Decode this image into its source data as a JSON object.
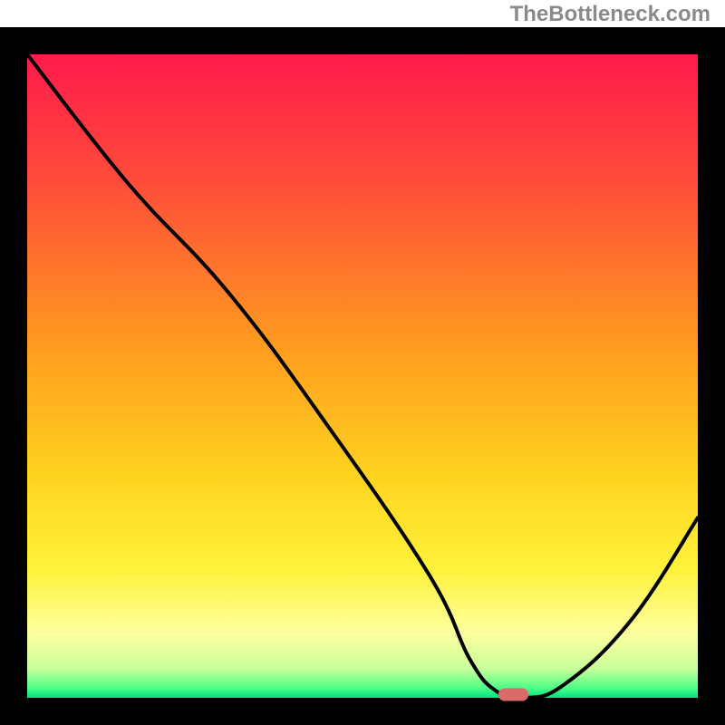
{
  "watermark": "TheBottleneck.com",
  "chart_data": {
    "type": "line",
    "title": "",
    "xlabel": "",
    "ylabel": "",
    "xlim": [
      0,
      100
    ],
    "ylim": [
      0,
      100
    ],
    "series": [
      {
        "name": "curve",
        "x": [
          0,
          15,
          30,
          45,
          60,
          66,
          70,
          74,
          80,
          90,
          100
        ],
        "values": [
          100,
          80,
          63,
          42,
          19,
          6,
          1,
          0,
          2,
          12,
          28
        ]
      }
    ],
    "marker": {
      "x": 72.5,
      "y": 0.5,
      "width": 4.5,
      "height": 2.0,
      "color": "#d96b6b"
    },
    "gradient_stops": [
      {
        "offset": 0.0,
        "color": "#ff1a4b"
      },
      {
        "offset": 0.2,
        "color": "#ff4d3a"
      },
      {
        "offset": 0.45,
        "color": "#ff9a1f"
      },
      {
        "offset": 0.65,
        "color": "#ffd21f"
      },
      {
        "offset": 0.8,
        "color": "#fff23a"
      },
      {
        "offset": 0.9,
        "color": "#fdffa0"
      },
      {
        "offset": 0.955,
        "color": "#c8ff9a"
      },
      {
        "offset": 0.985,
        "color": "#4dff88"
      },
      {
        "offset": 1.0,
        "color": "#00e080"
      }
    ],
    "frame_color": "#000000",
    "frame_width": 30,
    "line_color": "#000000",
    "line_width": 4
  }
}
